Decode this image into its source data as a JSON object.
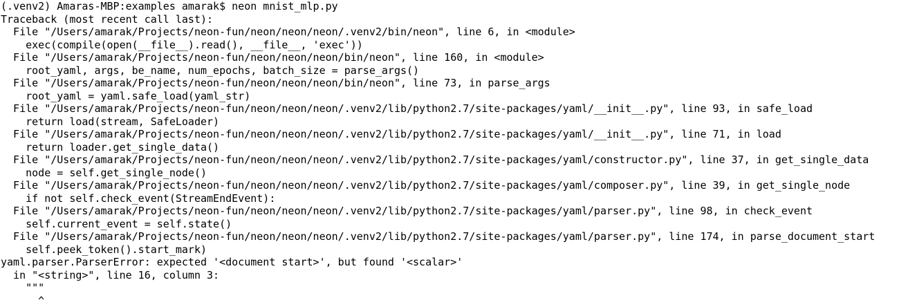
{
  "terminal": {
    "background": "#ffffff",
    "foreground": "#000000",
    "lines": [
      "(.venv2) Amaras-MBP:examples amarak$ neon mnist_mlp.py",
      "Traceback (most recent call last):",
      "  File \"/Users/amarak/Projects/neon-fun/neon/neon/neon/.venv2/bin/neon\", line 6, in <module>",
      "    exec(compile(open(__file__).read(), __file__, 'exec'))",
      "  File \"/Users/amarak/Projects/neon-fun/neon/neon/neon/bin/neon\", line 160, in <module>",
      "    root_yaml, args, be_name, num_epochs, batch_size = parse_args()",
      "  File \"/Users/amarak/Projects/neon-fun/neon/neon/neon/bin/neon\", line 73, in parse_args",
      "    root_yaml = yaml.safe_load(yaml_str)",
      "  File \"/Users/amarak/Projects/neon-fun/neon/neon/neon/.venv2/lib/python2.7/site-packages/yaml/__init__.py\", line 93, in safe_load",
      "    return load(stream, SafeLoader)",
      "  File \"/Users/amarak/Projects/neon-fun/neon/neon/neon/.venv2/lib/python2.7/site-packages/yaml/__init__.py\", line 71, in load",
      "    return loader.get_single_data()",
      "  File \"/Users/amarak/Projects/neon-fun/neon/neon/neon/.venv2/lib/python2.7/site-packages/yaml/constructor.py\", line 37, in get_single_data",
      "    node = self.get_single_node()",
      "  File \"/Users/amarak/Projects/neon-fun/neon/neon/neon/.venv2/lib/python2.7/site-packages/yaml/composer.py\", line 39, in get_single_node",
      "    if not self.check_event(StreamEndEvent):",
      "  File \"/Users/amarak/Projects/neon-fun/neon/neon/neon/.venv2/lib/python2.7/site-packages/yaml/parser.py\", line 98, in check_event",
      "    self.current_event = self.state()",
      "  File \"/Users/amarak/Projects/neon-fun/neon/neon/neon/.venv2/lib/python2.7/site-packages/yaml/parser.py\", line 174, in parse_document_start",
      "    self.peek_token().start_mark)",
      "yaml.parser.ParserError: expected '<document start>', but found '<scalar>'",
      "  in \"<string>\", line 16, column 3:",
      "    \"\"\"",
      "      ^"
    ]
  }
}
